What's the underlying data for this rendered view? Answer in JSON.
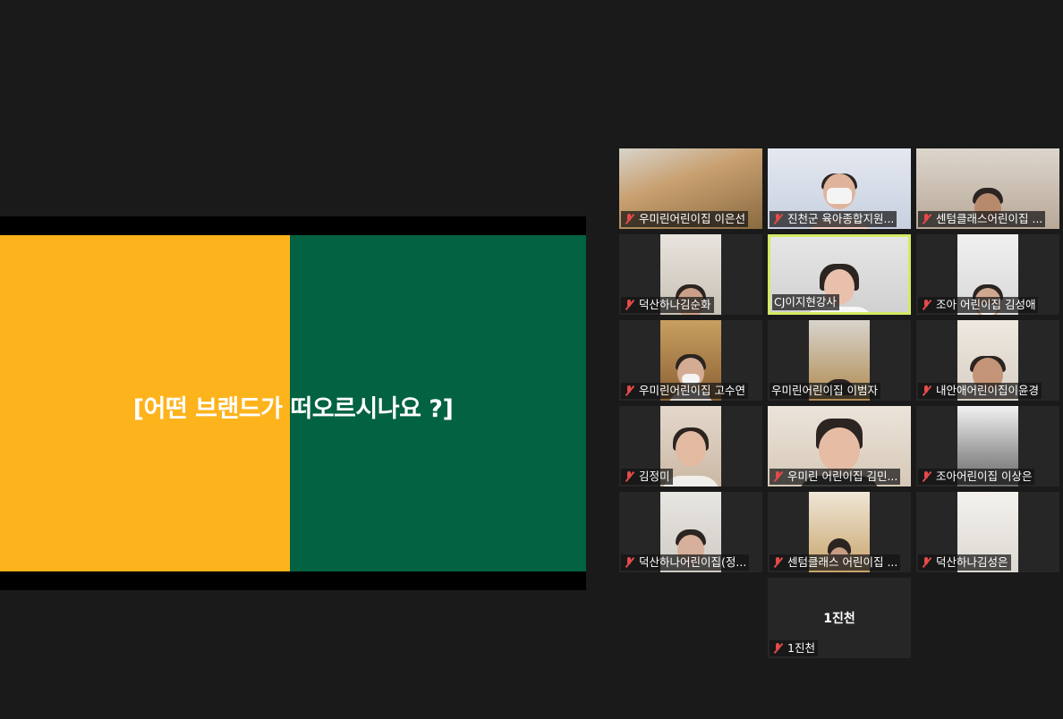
{
  "slide": {
    "text": "[어떤 브랜드가 떠오르시나요 ?]",
    "left_color": "#fdb31c",
    "right_color": "#026241"
  },
  "participants": [
    {
      "name": "우미린어린이집 이은선",
      "muted": true
    },
    {
      "name": "진천군 육아종합지원...",
      "muted": true
    },
    {
      "name": "센텀클래스어린이집 ...",
      "muted": true
    },
    {
      "name": "덕산하나김순화",
      "muted": true
    },
    {
      "name": "CJ이지현강사",
      "muted": false,
      "active": true
    },
    {
      "name": "조아 어린이집 김성애",
      "muted": true
    },
    {
      "name": "우미린어린이집 고수연",
      "muted": true
    },
    {
      "name": "우미린어린이집 이범자",
      "muted": false
    },
    {
      "name": "내안애어린이집이윤경",
      "muted": true
    },
    {
      "name": "김정미",
      "muted": true
    },
    {
      "name": "우미린 어린이집 김민...",
      "muted": true
    },
    {
      "name": "조아어린이집 이상은",
      "muted": true
    },
    {
      "name": "덕산하나어린이집(정...",
      "muted": true
    },
    {
      "name": "센텀클래스 어린이집 ...",
      "muted": true
    },
    {
      "name": "덕산하나김성은",
      "muted": true
    },
    {
      "name": "1진천",
      "muted": true,
      "no_video": true,
      "center_name": "1진천"
    }
  ],
  "icons": {
    "muted": "mic-muted-icon"
  },
  "colors": {
    "active_border": "#d6e964",
    "muted_icon": "#e54a4a",
    "background": "#1a1a1a"
  }
}
